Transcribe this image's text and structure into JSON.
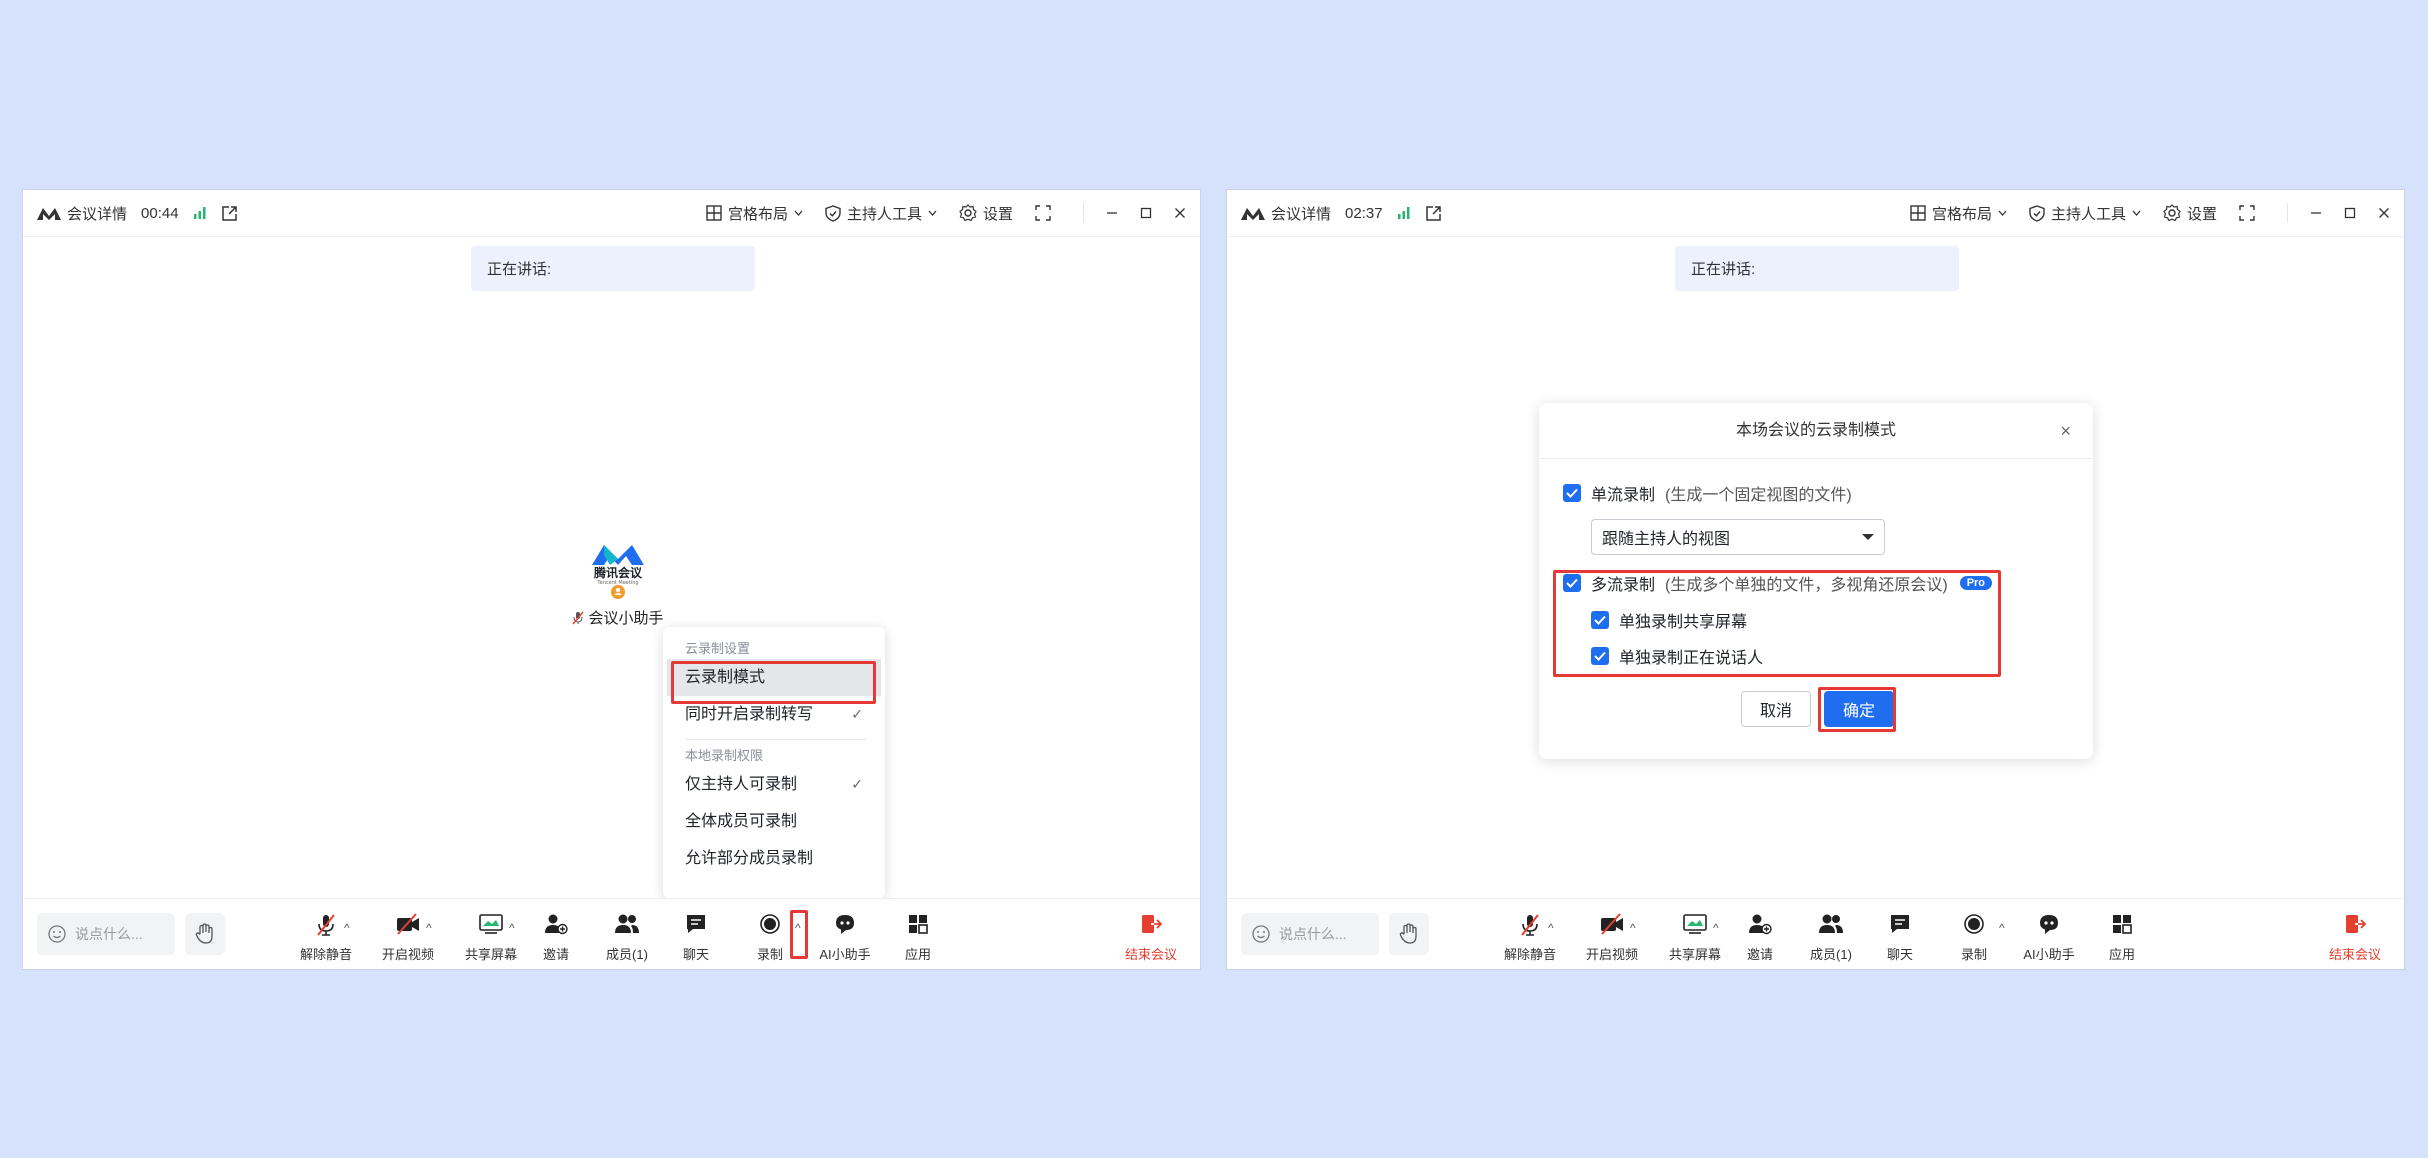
{
  "colors": {
    "accent": "#1f6ef0",
    "highlight": "#e53935",
    "end": "#e5402f",
    "signal": "#27b66f",
    "background": "#d6e2fb"
  },
  "left": {
    "title": "会议详情",
    "time": "00:44",
    "header": {
      "layout": "宫格布局",
      "host_tools": "主持人工具",
      "settings": "设置"
    },
    "speaking": "正在讲话:",
    "assistant": {
      "logo_text": "腾讯会议",
      "logo_sub": "Tencent Meeting",
      "name": "会议小助手"
    },
    "menu": {
      "section1": "云录制设置",
      "item_cloud_mode": "云录制模式",
      "item_transcribe": "同时开启录制转写",
      "section2": "本地录制权限",
      "item_host_only": "仅主持人可录制",
      "item_all": "全体成员可录制",
      "item_partial": "允许部分成员录制"
    },
    "toolbar": {
      "say": "说点什么...",
      "unmute": "解除静音",
      "video": "开启视频",
      "share": "共享屏幕",
      "invite": "邀请",
      "members": "成员(1)",
      "chat": "聊天",
      "record": "录制",
      "ai": "AI小助手",
      "apps": "应用",
      "end": "结束会议"
    }
  },
  "right": {
    "title": "会议详情",
    "time": "02:37",
    "header": {
      "layout": "宫格布局",
      "host_tools": "主持人工具",
      "settings": "设置"
    },
    "speaking": "正在讲话:",
    "dialog": {
      "title": "本场会议的云录制模式",
      "single": "单流录制",
      "single_note": "(生成一个固定视图的文件)",
      "select_value": "跟随主持人的视图",
      "multi": "多流录制",
      "multi_note": "(生成多个单独的文件，多视角还原会议)",
      "pro": "Pro",
      "sub_screen": "单独录制共享屏幕",
      "sub_speaker": "单独录制正在说话人",
      "cancel": "取消",
      "ok": "确定"
    },
    "toolbar": {
      "say": "说点什么...",
      "unmute": "解除静音",
      "video": "开启视频",
      "share": "共享屏幕",
      "invite": "邀请",
      "members": "成员(1)",
      "chat": "聊天",
      "record": "录制",
      "ai": "AI小助手",
      "apps": "应用",
      "end": "结束会议"
    }
  }
}
